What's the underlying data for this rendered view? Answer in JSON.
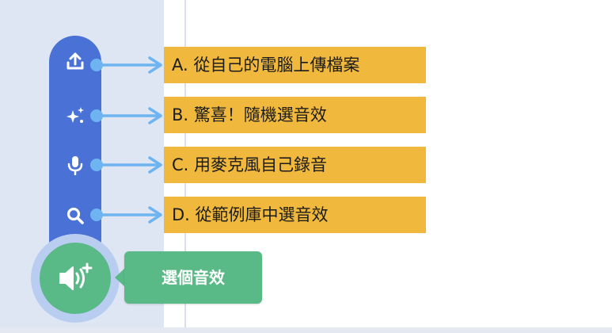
{
  "menu": {
    "items": [
      {
        "icon": "upload-icon",
        "label": "A. 從自己的電腦上傳檔案"
      },
      {
        "icon": "surprise-sparkle-icon",
        "label": "B. 驚喜！隨機選音效"
      },
      {
        "icon": "microphone-icon",
        "label": "C. 用麥克風自己錄音"
      },
      {
        "icon": "search-icon",
        "label": "D. 從範例庫中選音效"
      }
    ]
  },
  "main_button": {
    "icon": "add-sound-icon",
    "tooltip": "選個音效"
  },
  "colors": {
    "menu_bar": "#4a72d6",
    "main_button": "#59ba88",
    "label_background": "#f0b93e",
    "callout_arrow": "#6eb4f0",
    "left_panel": "#dfe6f3"
  }
}
